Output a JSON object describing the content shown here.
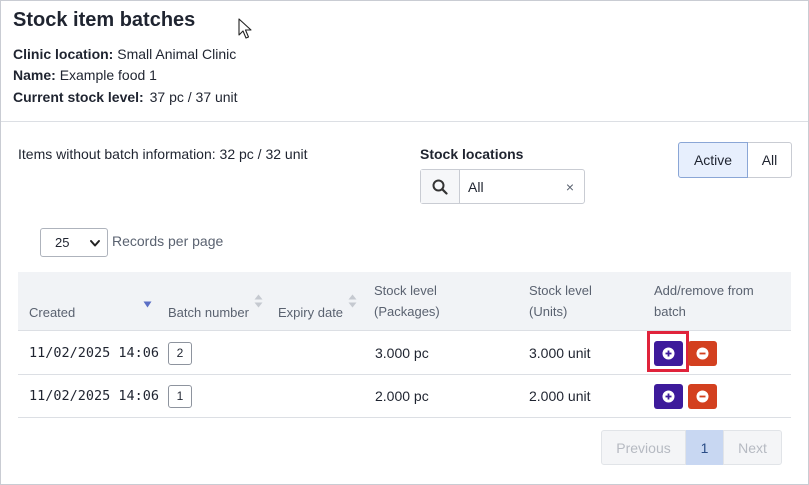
{
  "page": {
    "title": "Stock item batches"
  },
  "details": {
    "clinic_location_label": "Clinic location:",
    "clinic_location_value": "Small Animal Clinic",
    "name_label": "Name:",
    "name_value": "Example food 1",
    "stock_label": "Current stock level:",
    "stock_value": "37 pc / 37 unit"
  },
  "without_batch": {
    "label": "Items without batch information:",
    "value": "32 pc / 32 unit"
  },
  "stock_locations": {
    "label": "Stock locations",
    "value": "All",
    "clear_glyph": "×",
    "search_icon": "search-icon"
  },
  "filter_toggle": {
    "active_label": "Active",
    "all_label": "All",
    "selected": "Active"
  },
  "records": {
    "selected": "25",
    "label": "Records per page"
  },
  "table": {
    "headers": {
      "created": "Created",
      "batch_number": "Batch number",
      "expiry_date": "Expiry date",
      "stock_packages_line1": "Stock level",
      "stock_packages_line2": "(Packages)",
      "stock_units_line1": "Stock level",
      "stock_units_line2": "(Units)",
      "addremove_line1": "Add/remove from",
      "addremove_line2": "batch"
    },
    "rows": [
      {
        "created": "11/02/2025 14:06",
        "batch": "2",
        "expiry": "",
        "packages": "3.000 pc",
        "units": "3.000 unit"
      },
      {
        "created": "11/02/2025 14:06",
        "batch": "1",
        "expiry": "",
        "packages": "2.000 pc",
        "units": "2.000 unit"
      }
    ]
  },
  "pagination": {
    "previous": "Previous",
    "current": "1",
    "next": "Next"
  },
  "colors": {
    "add_button": "#3d1a9b",
    "remove_button": "#d3401f",
    "highlight": "#e0233b",
    "active_toggle": "#e7effd"
  }
}
